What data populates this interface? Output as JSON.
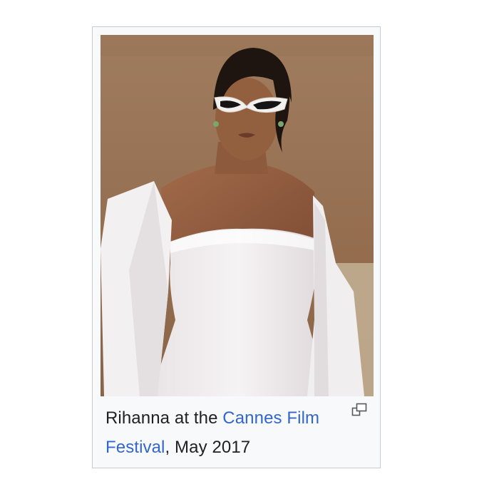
{
  "figure": {
    "image_subject": "Rihanna in white dress and white sunglasses",
    "caption": {
      "prefix": "Rihanna at the ",
      "link_text": "Cannes Film Festival",
      "suffix": ", May 2017"
    },
    "enlarge_icon": "magnify-clip-icon"
  }
}
